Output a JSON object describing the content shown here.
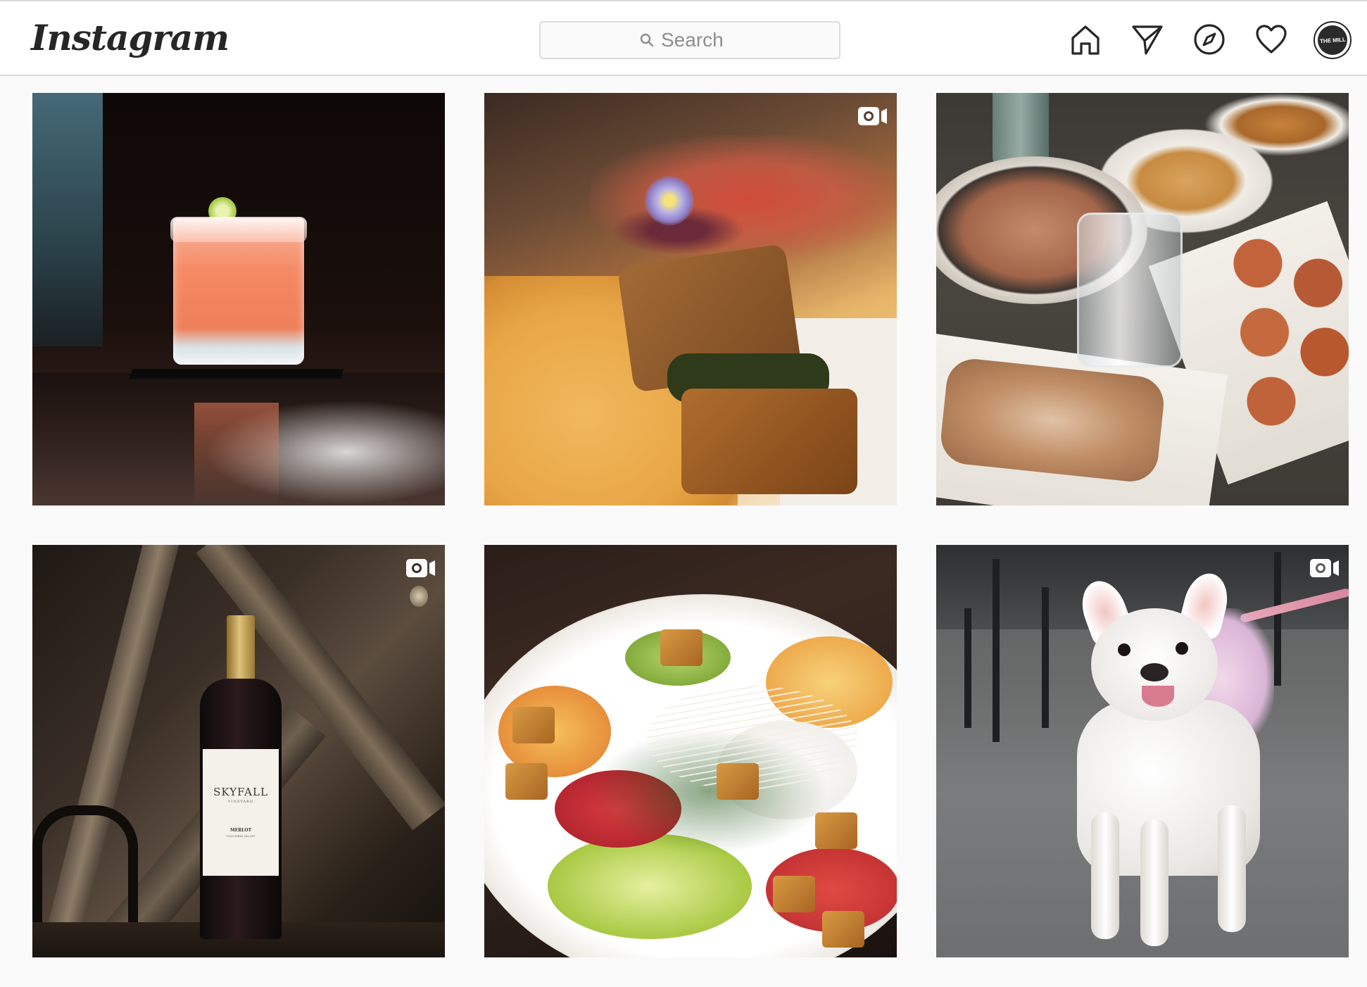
{
  "header": {
    "logo_text": "Instagram",
    "search": {
      "placeholder": "Search",
      "value": ""
    },
    "nav_icons": [
      "home-icon",
      "direct-messages-icon",
      "explore-icon",
      "activity-heart-icon"
    ],
    "avatar_text": "THE MILL"
  },
  "posts": [
    {
      "subject": "cocktail",
      "is_video": false
    },
    {
      "subject": "plated-food",
      "is_video": true
    },
    {
      "subject": "pastries",
      "is_video": false
    },
    {
      "subject": "wine-bottle",
      "is_video": true,
      "label": {
        "brand": "SKYFALL",
        "sub": "VINEYARD",
        "variety": "MERLOT",
        "region": "COLUMBIA VALLEY"
      }
    },
    {
      "subject": "salad",
      "is_video": false
    },
    {
      "subject": "french-bulldog",
      "is_video": true
    }
  ],
  "colors": {
    "header_bg": "#ffffff",
    "page_bg": "#fafafa",
    "border": "#dbdbdb",
    "icon": "#262626",
    "placeholder": "#8e8e8e"
  }
}
